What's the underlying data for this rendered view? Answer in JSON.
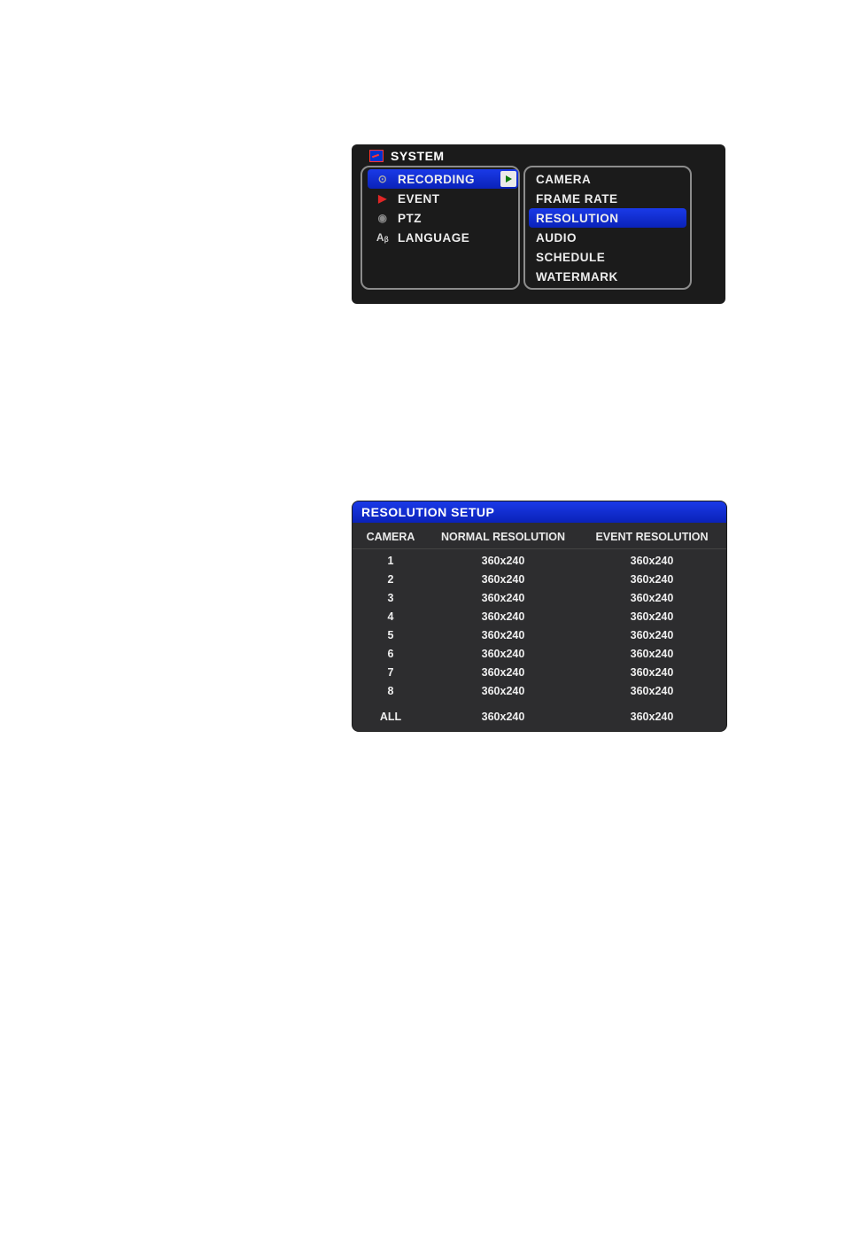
{
  "topMenu": {
    "header": "SYSTEM",
    "left": [
      {
        "label": "RECORDING",
        "selected": true,
        "icon": "rec"
      },
      {
        "label": "EVENT",
        "selected": false,
        "icon": "event"
      },
      {
        "label": "PTZ",
        "selected": false,
        "icon": "ptz"
      },
      {
        "label": "LANGUAGE",
        "selected": false,
        "icon": "lang"
      }
    ],
    "right": [
      {
        "label": "CAMERA",
        "selected": false
      },
      {
        "label": "FRAME RATE",
        "selected": false
      },
      {
        "label": "RESOLUTION",
        "selected": true
      },
      {
        "label": "AUDIO",
        "selected": false
      },
      {
        "label": "SCHEDULE",
        "selected": false
      },
      {
        "label": "WATERMARK",
        "selected": false
      }
    ]
  },
  "resTable": {
    "title": "RESOLUTION SETUP",
    "headers": {
      "c1": "CAMERA",
      "c2": "NORMAL RESOLUTION",
      "c3": "EVENT RESOLUTION"
    },
    "rows": [
      {
        "cam": "1",
        "normal": "360x240",
        "event": "360x240"
      },
      {
        "cam": "2",
        "normal": "360x240",
        "event": "360x240"
      },
      {
        "cam": "3",
        "normal": "360x240",
        "event": "360x240"
      },
      {
        "cam": "4",
        "normal": "360x240",
        "event": "360x240"
      },
      {
        "cam": "5",
        "normal": "360x240",
        "event": "360x240"
      },
      {
        "cam": "6",
        "normal": "360x240",
        "event": "360x240"
      },
      {
        "cam": "7",
        "normal": "360x240",
        "event": "360x240"
      },
      {
        "cam": "8",
        "normal": "360x240",
        "event": "360x240"
      }
    ],
    "summary": {
      "cam": "ALL",
      "normal": "360x240",
      "event": "360x240"
    }
  }
}
